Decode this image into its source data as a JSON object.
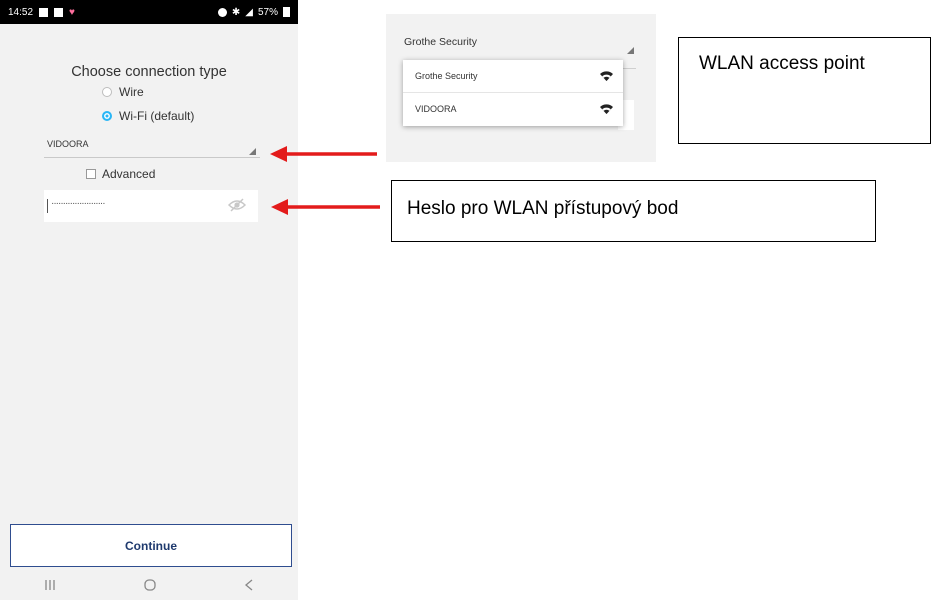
{
  "phone": {
    "status_bar": {
      "time": "14:52",
      "battery": "57%"
    },
    "title": "Choose connection type",
    "connection_options": [
      {
        "label": "Wire",
        "selected": false
      },
      {
        "label": "Wi-Fi (default)",
        "selected": true
      }
    ],
    "ssid_value": "VIDOORA",
    "advanced_label": "Advanced",
    "advanced_checked": false,
    "password_masked": "·······················",
    "continue_label": "Continue",
    "nav_icons": [
      "recent-apps-icon",
      "home-icon",
      "back-icon"
    ]
  },
  "inset": {
    "selected_value": "Grothe Security",
    "dropdown_items": [
      {
        "label": "Grothe Security",
        "icon": "wifi-icon"
      },
      {
        "label": "VIDOORA",
        "icon": "wifi-icon"
      }
    ]
  },
  "callouts": {
    "wlan": "WLAN access point",
    "heslo": "Heslo pro WLAN přístupový bod"
  },
  "colors": {
    "accent_radio": "#29b6f6",
    "button_border": "#2f4d8f",
    "arrow": "#e31b1b"
  }
}
